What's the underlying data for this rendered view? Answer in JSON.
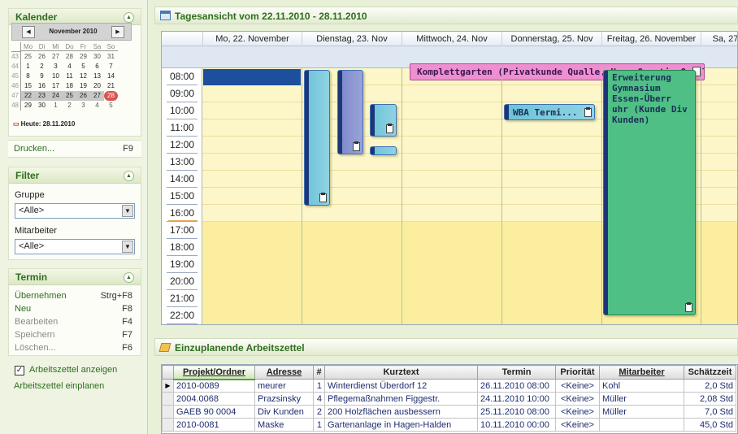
{
  "sidebar": {
    "calendar": {
      "title": "Kalender",
      "month_label": "November 2010",
      "weekdays": [
        "Mo",
        "Di",
        "Mi",
        "Do",
        "Fr",
        "Sa",
        "So"
      ],
      "weeks": [
        {
          "wk": "43",
          "days": [
            "25",
            "26",
            "27",
            "28",
            "29",
            "30",
            "31"
          ]
        },
        {
          "wk": "44",
          "days": [
            "1",
            "2",
            "3",
            "4",
            "5",
            "6",
            "7"
          ]
        },
        {
          "wk": "45",
          "days": [
            "8",
            "9",
            "10",
            "11",
            "12",
            "13",
            "14"
          ]
        },
        {
          "wk": "46",
          "days": [
            "15",
            "16",
            "17",
            "18",
            "19",
            "20",
            "21"
          ]
        },
        {
          "wk": "47",
          "days": [
            "22",
            "23",
            "24",
            "25",
            "26",
            "27",
            "28"
          ]
        },
        {
          "wk": "48",
          "days": [
            "29",
            "30",
            "1",
            "2",
            "3",
            "4",
            "5"
          ]
        }
      ],
      "today_label": "Heute: 28.11.2010"
    },
    "print": {
      "label": "Drucken...",
      "key": "F9"
    },
    "filter": {
      "title": "Filter",
      "group_label": "Gruppe",
      "group_value": "<Alle>",
      "employee_label": "Mitarbeiter",
      "employee_value": "<Alle>"
    },
    "termin": {
      "title": "Termin",
      "items": [
        {
          "label": "Übernehmen",
          "key": "Strg+F8"
        },
        {
          "label": "Neu",
          "key": "F8"
        },
        {
          "label": "Bearbeiten",
          "key": "F4"
        },
        {
          "label": "Speichern",
          "key": "F7"
        },
        {
          "label": "Löschen...",
          "key": "F6"
        }
      ]
    },
    "worksheet": {
      "show_label": "Arbeitszettel anzeigen",
      "show_checked": true,
      "plan_label": "Arbeitszettel einplanen"
    }
  },
  "main": {
    "title": "Tagesansicht vom 22.11.2010 - 28.11.2010",
    "days": [
      "Mo, 22. November",
      "Dienstag, 23. Nov",
      "Mittwoch, 24. Nov",
      "Donnerstag, 25. Nov",
      "Freitag, 26. November",
      "Sa, 27"
    ],
    "hours": [
      "08:00",
      "09:00",
      "10:00",
      "11:00",
      "12:00",
      "13:00",
      "14:00",
      "15:00",
      "16:00",
      "17:00",
      "18:00",
      "19:00",
      "20:00",
      "21:00",
      "22:00"
    ],
    "allday_appointment": "Komplettgarten (Privatkunde Qualle, Herr Quentin Qualle...",
    "appointments": {
      "wba": "WBA Termi...",
      "fri": "Erweiterung Gymnasium Essen-Überr uhr (Kunde Div Kunden)"
    }
  },
  "worksheets": {
    "title": "Einzuplanende Arbeitszettel",
    "columns": [
      "Projekt/Ordner",
      "Adresse",
      "#",
      "Kurztext",
      "Termin",
      "Priorität",
      "Mitarbeiter",
      "Schätzzeit"
    ],
    "rows": [
      [
        "2010-0089",
        "meurer",
        "1",
        "Winterdienst Überdorf 12",
        "26.11.2010 08:00",
        "<Keine>",
        "Kohl",
        "2,0 Std"
      ],
      [
        "2004.0068",
        "Prazsinsky",
        "4",
        "Pflegemaßnahmen Figgestr.",
        "24.11.2010 10:00",
        "<Keine>",
        "Müller",
        "2,08 Std"
      ],
      [
        "GAEB 90 0004",
        "Div Kunden",
        "2",
        "200 Holzflächen ausbessern",
        "25.11.2010 08:00",
        "<Keine>",
        "Müller",
        "7,0 Std"
      ],
      [
        "2010-0081",
        "Maske",
        "1",
        "Gartenanlage in Hagen-Halden",
        "10.11.2010 00:00",
        "<Keine>",
        "",
        "45,0 Std"
      ]
    ]
  },
  "colors": {
    "accent_green": "#2f6e1f",
    "appointment_cyan": "#6cc2d8",
    "appointment_purple": "#7b86c9",
    "appointment_green": "#4fbf86",
    "allday_pink": "#ef8fd0",
    "today_red": "#c0392b"
  }
}
